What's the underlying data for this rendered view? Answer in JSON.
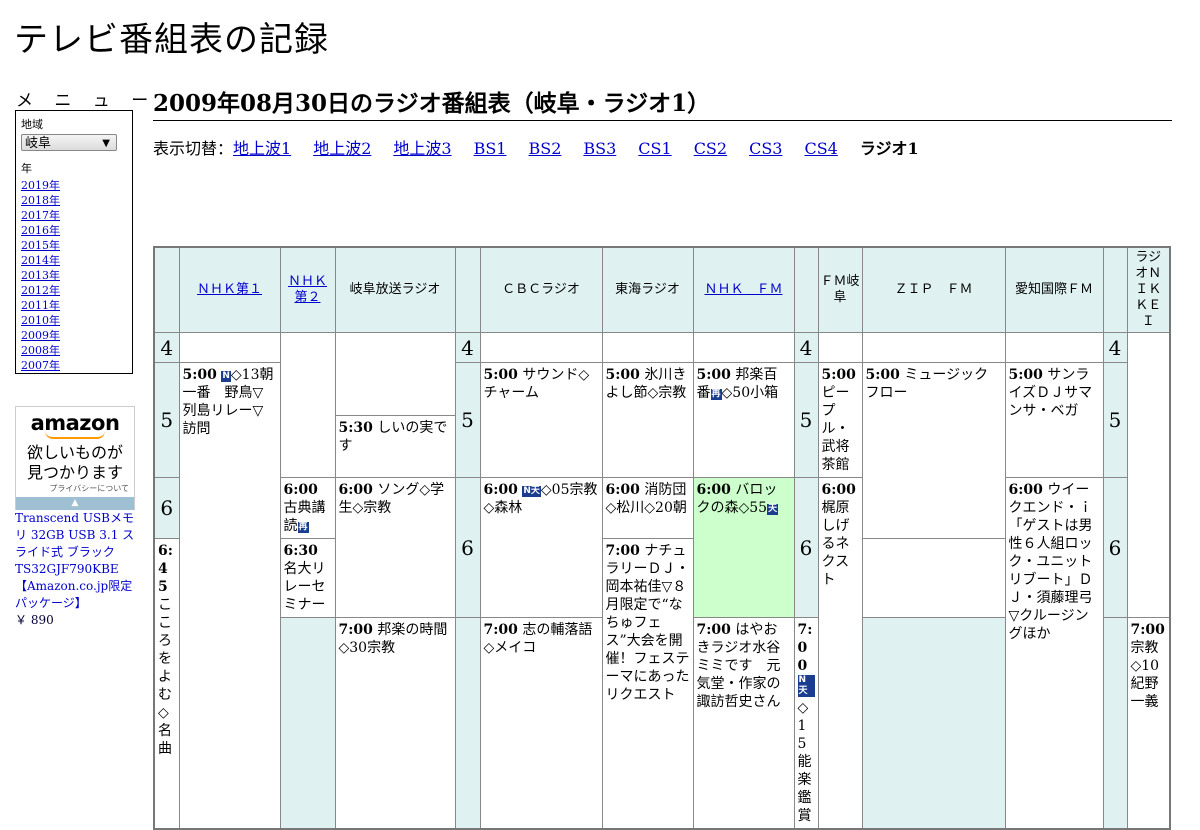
{
  "site_title": "テレビ番組表の記録",
  "menu": {
    "heading": "メ ニ ュ ー",
    "region_label": "地域",
    "region_value": "岐阜",
    "year_label": "年",
    "years": [
      "2019年",
      "2018年",
      "2017年",
      "2016年",
      "2015年",
      "2014年",
      "2013年",
      "2012年",
      "2011年",
      "2010年",
      "2009年",
      "2008年",
      "2007年"
    ]
  },
  "ad": {
    "brand": "amazon",
    "message_1": "欲しいものが",
    "message_2": "見つかります",
    "privacy": "プライバシーについて",
    "product_text": "Transcend USBメモリ 32GB USB 3.1 スライド式 ブラック TS32GJF790KBE 【Amazon.co.jp限定パッケージ】",
    "price": "￥ 890"
  },
  "page_title": "2009年08月30日のラジオ番組表（岐阜・ラジオ1）",
  "switch": {
    "label": "表示切替：",
    "links": [
      "地上波1",
      "地上波2",
      "地上波3",
      "BS1",
      "BS2",
      "BS3",
      "CS1",
      "CS2",
      "CS3",
      "CS4"
    ],
    "current": "ラジオ1"
  },
  "stations": [
    {
      "name": "ＮＨＫ第１",
      "link": true
    },
    {
      "name": "ＮＨＫ第２",
      "link": true
    },
    {
      "name": "岐阜放送ラジオ",
      "link": false
    },
    {
      "name": "ＣＢＣラジオ",
      "link": false
    },
    {
      "name": "東海ラジオ",
      "link": false
    },
    {
      "name": "ＮＨＫ　ＦＭ",
      "link": true
    },
    {
      "name": "ＦＭ岐阜",
      "link": false
    },
    {
      "name": "ＺＩＰ　ＦＭ",
      "link": false
    },
    {
      "name": "愛知国際ＦＭ",
      "link": false
    },
    {
      "name": "ラジオＮＩＫＫＥＩ",
      "link": false
    }
  ],
  "hours": [
    "4",
    "5",
    "6"
  ],
  "programs": {
    "nhk1_500": {
      "time": "5:00",
      "badge": "N",
      "text": "◇13朝一番　野鳥▽列島リレー▽訪問"
    },
    "gifu_530": {
      "time": "5:30",
      "text": "しいの実です"
    },
    "cbc_500": {
      "time": "5:00",
      "text": "サウンド◇チャーム"
    },
    "tokai_500": {
      "time": "5:00",
      "text": "氷川きよし節◇宗教"
    },
    "nhkfm_500": {
      "time": "5:00",
      "text": "邦楽百番",
      "badge": "再",
      "text2": "◇50小箱"
    },
    "fmgifu_500": {
      "time": "5:00",
      "text": "ピープル・武将茶館"
    },
    "zip_500": {
      "time": "5:00",
      "text": "ミュージックフロー"
    },
    "aichi_500": {
      "time": "5:00",
      "text": "サンライズＤＪサマンサ・ベガ"
    },
    "nhk2_600": {
      "time": "6:00",
      "text": "古典講読",
      "badge": "再"
    },
    "gifu_600": {
      "time": "6:00",
      "text": "ソング◇学生◇宗教"
    },
    "cbc_600": {
      "time": "6:00",
      "badge": "N天",
      "text": "◇05宗教◇森林"
    },
    "tokai_600": {
      "time": "6:00",
      "text": "消防団◇松川◇20朝"
    },
    "nhkfm_600": {
      "time": "6:00",
      "text": "バロックの森◇55",
      "badge": "天"
    },
    "fmgifu_600": {
      "time": "6:00",
      "text": "梶原しげるネクスト"
    },
    "aichi_600": {
      "time": "6:00",
      "text": "ウイークエンド・ｉ「ゲストは男性６人組ロック・ユニット リブート」ＤＪ・須藤理弓▽クルージングほか"
    },
    "tokai_630": {
      "time": "6:30",
      "text": "名大リレーセミナー"
    },
    "nhk2_645": {
      "time": "6:45",
      "text": "こころをよむ◇名曲"
    },
    "gifu_700": {
      "time": "7:00",
      "text": "邦楽の時間◇30宗教"
    },
    "cbc_700": {
      "time": "7:00",
      "text": "志の輔落語◇メイコ"
    },
    "tokai_700": {
      "time": "7:00",
      "text": "はやおきラジオ水谷ミミです　元気堂・作家の諏訪哲史さん"
    },
    "nhkfm_700": {
      "time": "7:00",
      "badge": "N天",
      "text": "◇15能楽鑑賞"
    },
    "zip_700": {
      "time": "7:00",
      "text": "ナチュラリーＤＪ・岡本祐佳▽８月限定で“なちゅフェス”大会を開催！フェステーマにあったリクエスト"
    },
    "nikkei_700": {
      "time": "7:00",
      "text": "宗教◇10紀野一義"
    }
  },
  "colors": {
    "header_bg": "#dff1f1",
    "highlight_bg": "#ccffcc",
    "link": "#0000cc"
  }
}
